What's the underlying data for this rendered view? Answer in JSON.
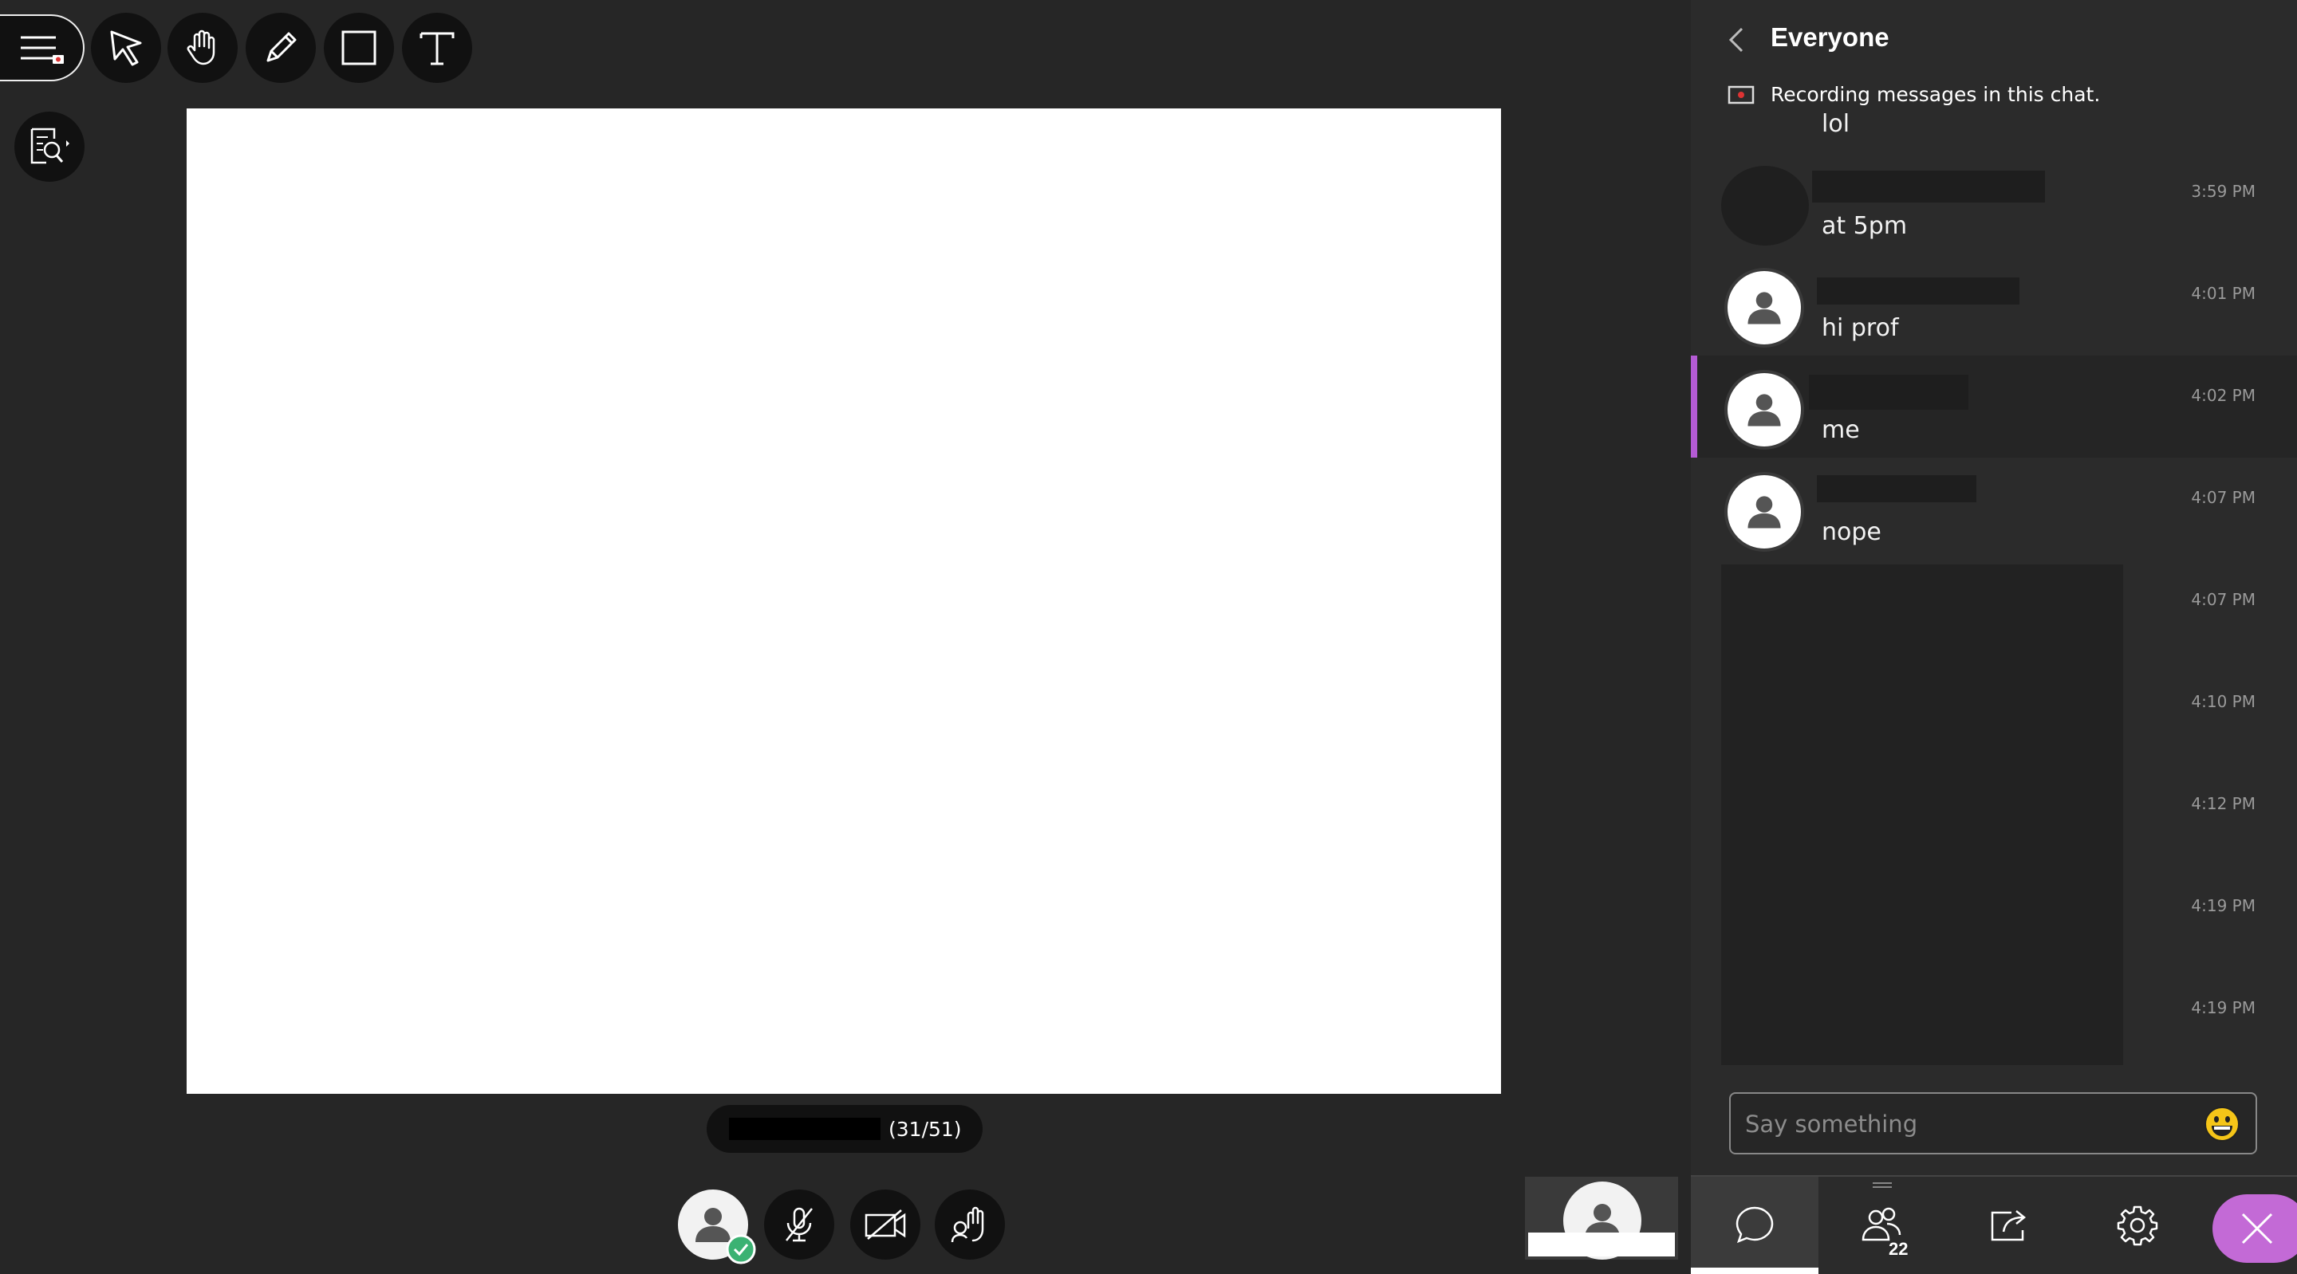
{
  "toolbar": {
    "tools": [
      {
        "name": "select-arrow-icon"
      },
      {
        "name": "pan-hand-icon"
      },
      {
        "name": "pencil-icon"
      },
      {
        "name": "rectangle-icon"
      },
      {
        "name": "text-tool-icon"
      }
    ],
    "menu_icon": "hamburger-menu-icon",
    "zoom_icon": "document-search-icon"
  },
  "presentation": {
    "page_counter": "(31/51)"
  },
  "media_controls": {
    "avatar_status": "online",
    "buttons": [
      "microphone-muted-icon",
      "camera-off-icon",
      "raise-hand-icon"
    ]
  },
  "chat": {
    "title": "Everyone",
    "recording_notice": "Recording messages in this chat.",
    "first_message_tail": "lol",
    "messages": [
      {
        "text": "at 5pm",
        "time": "3:59 PM"
      },
      {
        "text": "hi prof",
        "time": "4:01 PM"
      },
      {
        "text": "me",
        "time": "4:02 PM"
      },
      {
        "text": "nope",
        "time": "4:07 PM"
      }
    ],
    "hidden_times": [
      "4:07 PM",
      "4:10 PM",
      "4:12 PM",
      "4:19 PM",
      "4:19 PM"
    ],
    "input_placeholder": "Say something",
    "highlight_color": "#b45bd4"
  },
  "bottom_tabs": {
    "participants_count": "22",
    "items": [
      "chat-bubble-icon",
      "participants-icon",
      "share-content-icon",
      "settings-gear-icon",
      "close-panel-icon"
    ],
    "close_color": "#c36ad6"
  }
}
